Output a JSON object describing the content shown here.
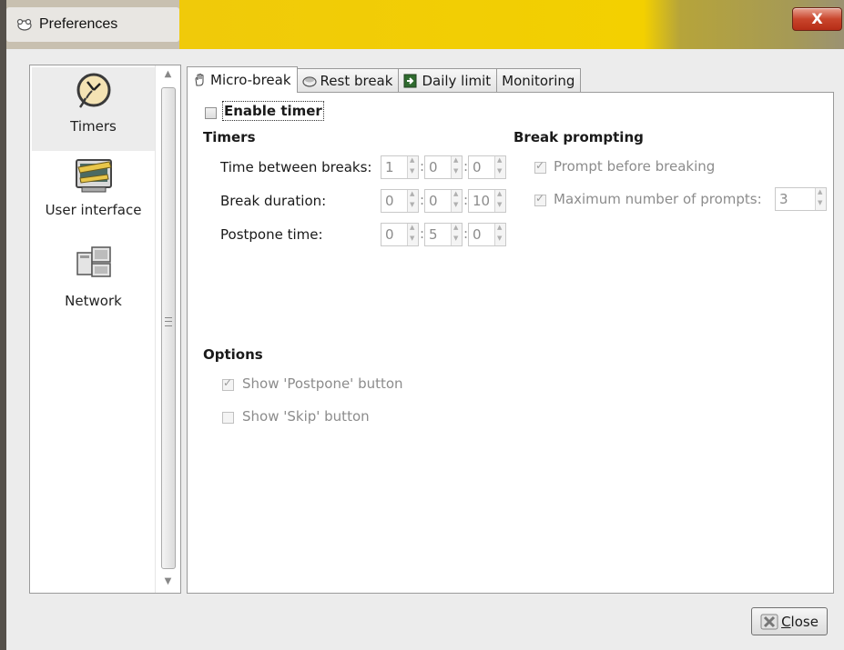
{
  "window": {
    "title": "Preferences",
    "close_glyph": "X"
  },
  "sidebar": {
    "items": [
      {
        "label": "Timers",
        "icon": "clock-icon",
        "selected": true
      },
      {
        "label": "User interface",
        "icon": "monitor-ruler-icon",
        "selected": false
      },
      {
        "label": "Network",
        "icon": "network-computers-icon",
        "selected": false
      }
    ]
  },
  "tabs": [
    {
      "label": "Micro-break",
      "icon": "hand-icon",
      "active": true
    },
    {
      "label": "Rest break",
      "icon": "bed-icon",
      "active": false
    },
    {
      "label": "Daily limit",
      "icon": "exit-icon",
      "active": false
    },
    {
      "label": "Monitoring",
      "icon": "",
      "active": false
    }
  ],
  "micro_break": {
    "enable_timer_label": "Enable timer",
    "enable_timer_checked": false,
    "timers_heading": "Timers",
    "time_between_label": "Time between breaks:",
    "time_between": [
      "1",
      "0",
      "0"
    ],
    "break_duration_label": "Break duration:",
    "break_duration": [
      "0",
      "0",
      "10"
    ],
    "postpone_label": "Postpone time:",
    "postpone": [
      "0",
      "5",
      "0"
    ],
    "separator": ":",
    "break_prompting_heading": "Break prompting",
    "prompt_before_label": "Prompt before breaking",
    "prompt_before_checked": true,
    "max_prompts_label": "Maximum number of prompts:",
    "max_prompts_checked": true,
    "max_prompts_value": "3",
    "options_heading": "Options",
    "show_postpone_label": "Show 'Postpone' button",
    "show_postpone_checked": true,
    "show_skip_label": "Show 'Skip' button",
    "show_skip_checked": false
  },
  "footer": {
    "close_label_prefix": "",
    "close_mnemonic": "C",
    "close_label_rest": "lose"
  },
  "colors": {
    "title_accent": "#f3d000",
    "close_red": "#c9452c",
    "disabled_text": "#8c8c8c"
  }
}
